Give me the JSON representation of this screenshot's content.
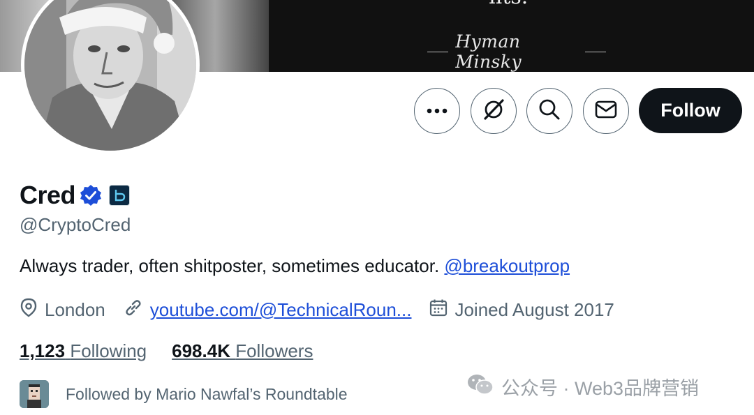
{
  "banner": {
    "quote_tail": "nts.",
    "signature": "Hyman Minsky"
  },
  "actions": {
    "more_icon": "more-dots-icon",
    "grok_icon": "grok-icon",
    "search_icon": "search-icon",
    "message_icon": "envelope-icon",
    "follow_label": "Follow"
  },
  "profile": {
    "display_name": "Cred",
    "verified_icon": "verified-badge-icon",
    "affiliation_icon": "breakout-affiliate-badge",
    "handle": "@CryptoCred",
    "bio_text": "Always trader, often shitposter, sometimes educator. ",
    "bio_mention": "@breakoutprop",
    "location": "London",
    "website": "youtube.com/@TechnicalRoun...",
    "joined": "Joined August 2017"
  },
  "stats": {
    "following_count": "1,123",
    "following_label": "Following",
    "followers_count": "698.4K",
    "followers_label": "Followers"
  },
  "followed_by": {
    "text": "Followed by Mario Nawfal’s Roundtable"
  },
  "watermark": {
    "text": "公众号 · Web3品牌营销"
  },
  "colors": {
    "accent_link": "#1d4ed8",
    "verified_blue": "#1d9bf0",
    "button_dark": "#0f1419",
    "muted_text": "#536471"
  }
}
